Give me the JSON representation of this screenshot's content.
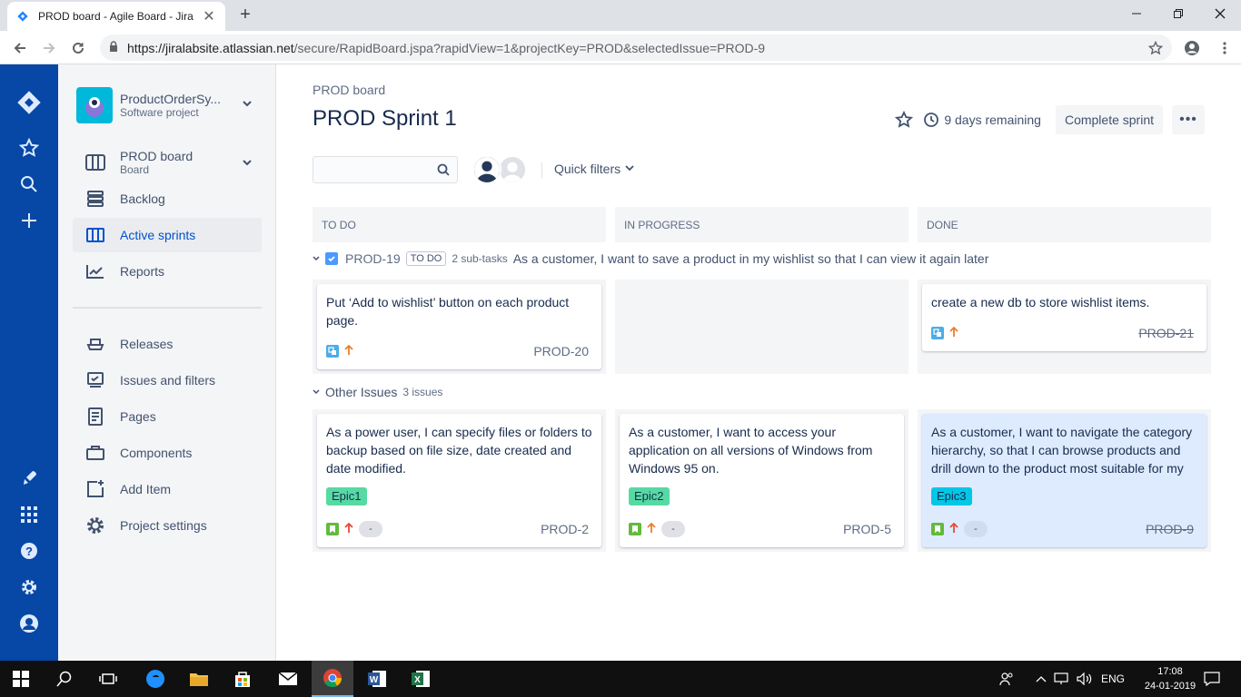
{
  "browser": {
    "tab_title": "PROD board - Agile Board - Jira",
    "url_host": "https://jiralabsite.atlassian.net",
    "url_path": "/secure/RapidBoard.jspa?rapidView=1&projectKey=PROD&selectedIssue=PROD-9"
  },
  "sidebar": {
    "project_name": "ProductOrderSy...",
    "project_type": "Software project",
    "board_name": "PROD board",
    "board_sub": "Board",
    "items": [
      {
        "label": "Backlog",
        "icon": "backlog-icon"
      },
      {
        "label": "Active sprints",
        "icon": "columns-icon",
        "active": true
      },
      {
        "label": "Reports",
        "icon": "chart-icon"
      },
      {
        "label": "Releases",
        "icon": "ship-icon"
      },
      {
        "label": "Issues and filters",
        "icon": "issues-icon"
      },
      {
        "label": "Pages",
        "icon": "page-icon"
      },
      {
        "label": "Components",
        "icon": "components-icon"
      },
      {
        "label": "Add Item",
        "icon": "add-item-icon"
      },
      {
        "label": "Project settings",
        "icon": "gear-icon"
      }
    ]
  },
  "header": {
    "breadcrumb": "PROD board",
    "title": "PROD Sprint 1",
    "remaining": "9 days remaining",
    "complete_label": "Complete sprint",
    "more_label": "•••",
    "quick_filters": "Quick filters"
  },
  "columns": [
    "TO DO",
    "IN PROGRESS",
    "DONE"
  ],
  "swimlane1": {
    "key": "PROD-19",
    "status": "TO DO",
    "subtasks": "2 sub-tasks",
    "summary": "As a customer, I want to save a product in my wishlist so that I can view it again later",
    "cards": [
      {
        "text": "Put ‘Add to wishlist’ button on each product page.",
        "key": "PROD-20"
      },
      {
        "text": "create a new db to store wishlist items.",
        "key": "PROD-21"
      }
    ]
  },
  "swimlane2": {
    "title": "Other Issues",
    "count": "3 issues",
    "cards": [
      {
        "text": "As a power user, I can specify files or folders to backup based on file size, date created and date modified.",
        "epic": "Epic1",
        "epic_color": "#57d9a3",
        "estimate": "-",
        "key": "PROD-2"
      },
      {
        "text": "As a customer, I want to access your application on all versions of Windows from Windows 95 on.",
        "epic": "Epic2",
        "epic_color": "#57d9a3",
        "estimate": "-",
        "key": "PROD-5"
      },
      {
        "text": "As a customer, I want to navigate the category hierarchy, so that I can browse products and drill down to the product most suitable for my",
        "epic": "Epic3",
        "epic_color": "#00c7e6",
        "estimate": "-",
        "key": "PROD-9"
      }
    ]
  },
  "taskbar": {
    "lang": "ENG",
    "time": "17:08",
    "date": "24-01-2019"
  },
  "colors": {
    "jira_blue": "#0747a6",
    "link_blue": "#0052cc",
    "story_green": "#63ba3c",
    "subtask_blue": "#4bade8",
    "priority_high": "#e5493a",
    "priority_medium": "#e97f33"
  }
}
